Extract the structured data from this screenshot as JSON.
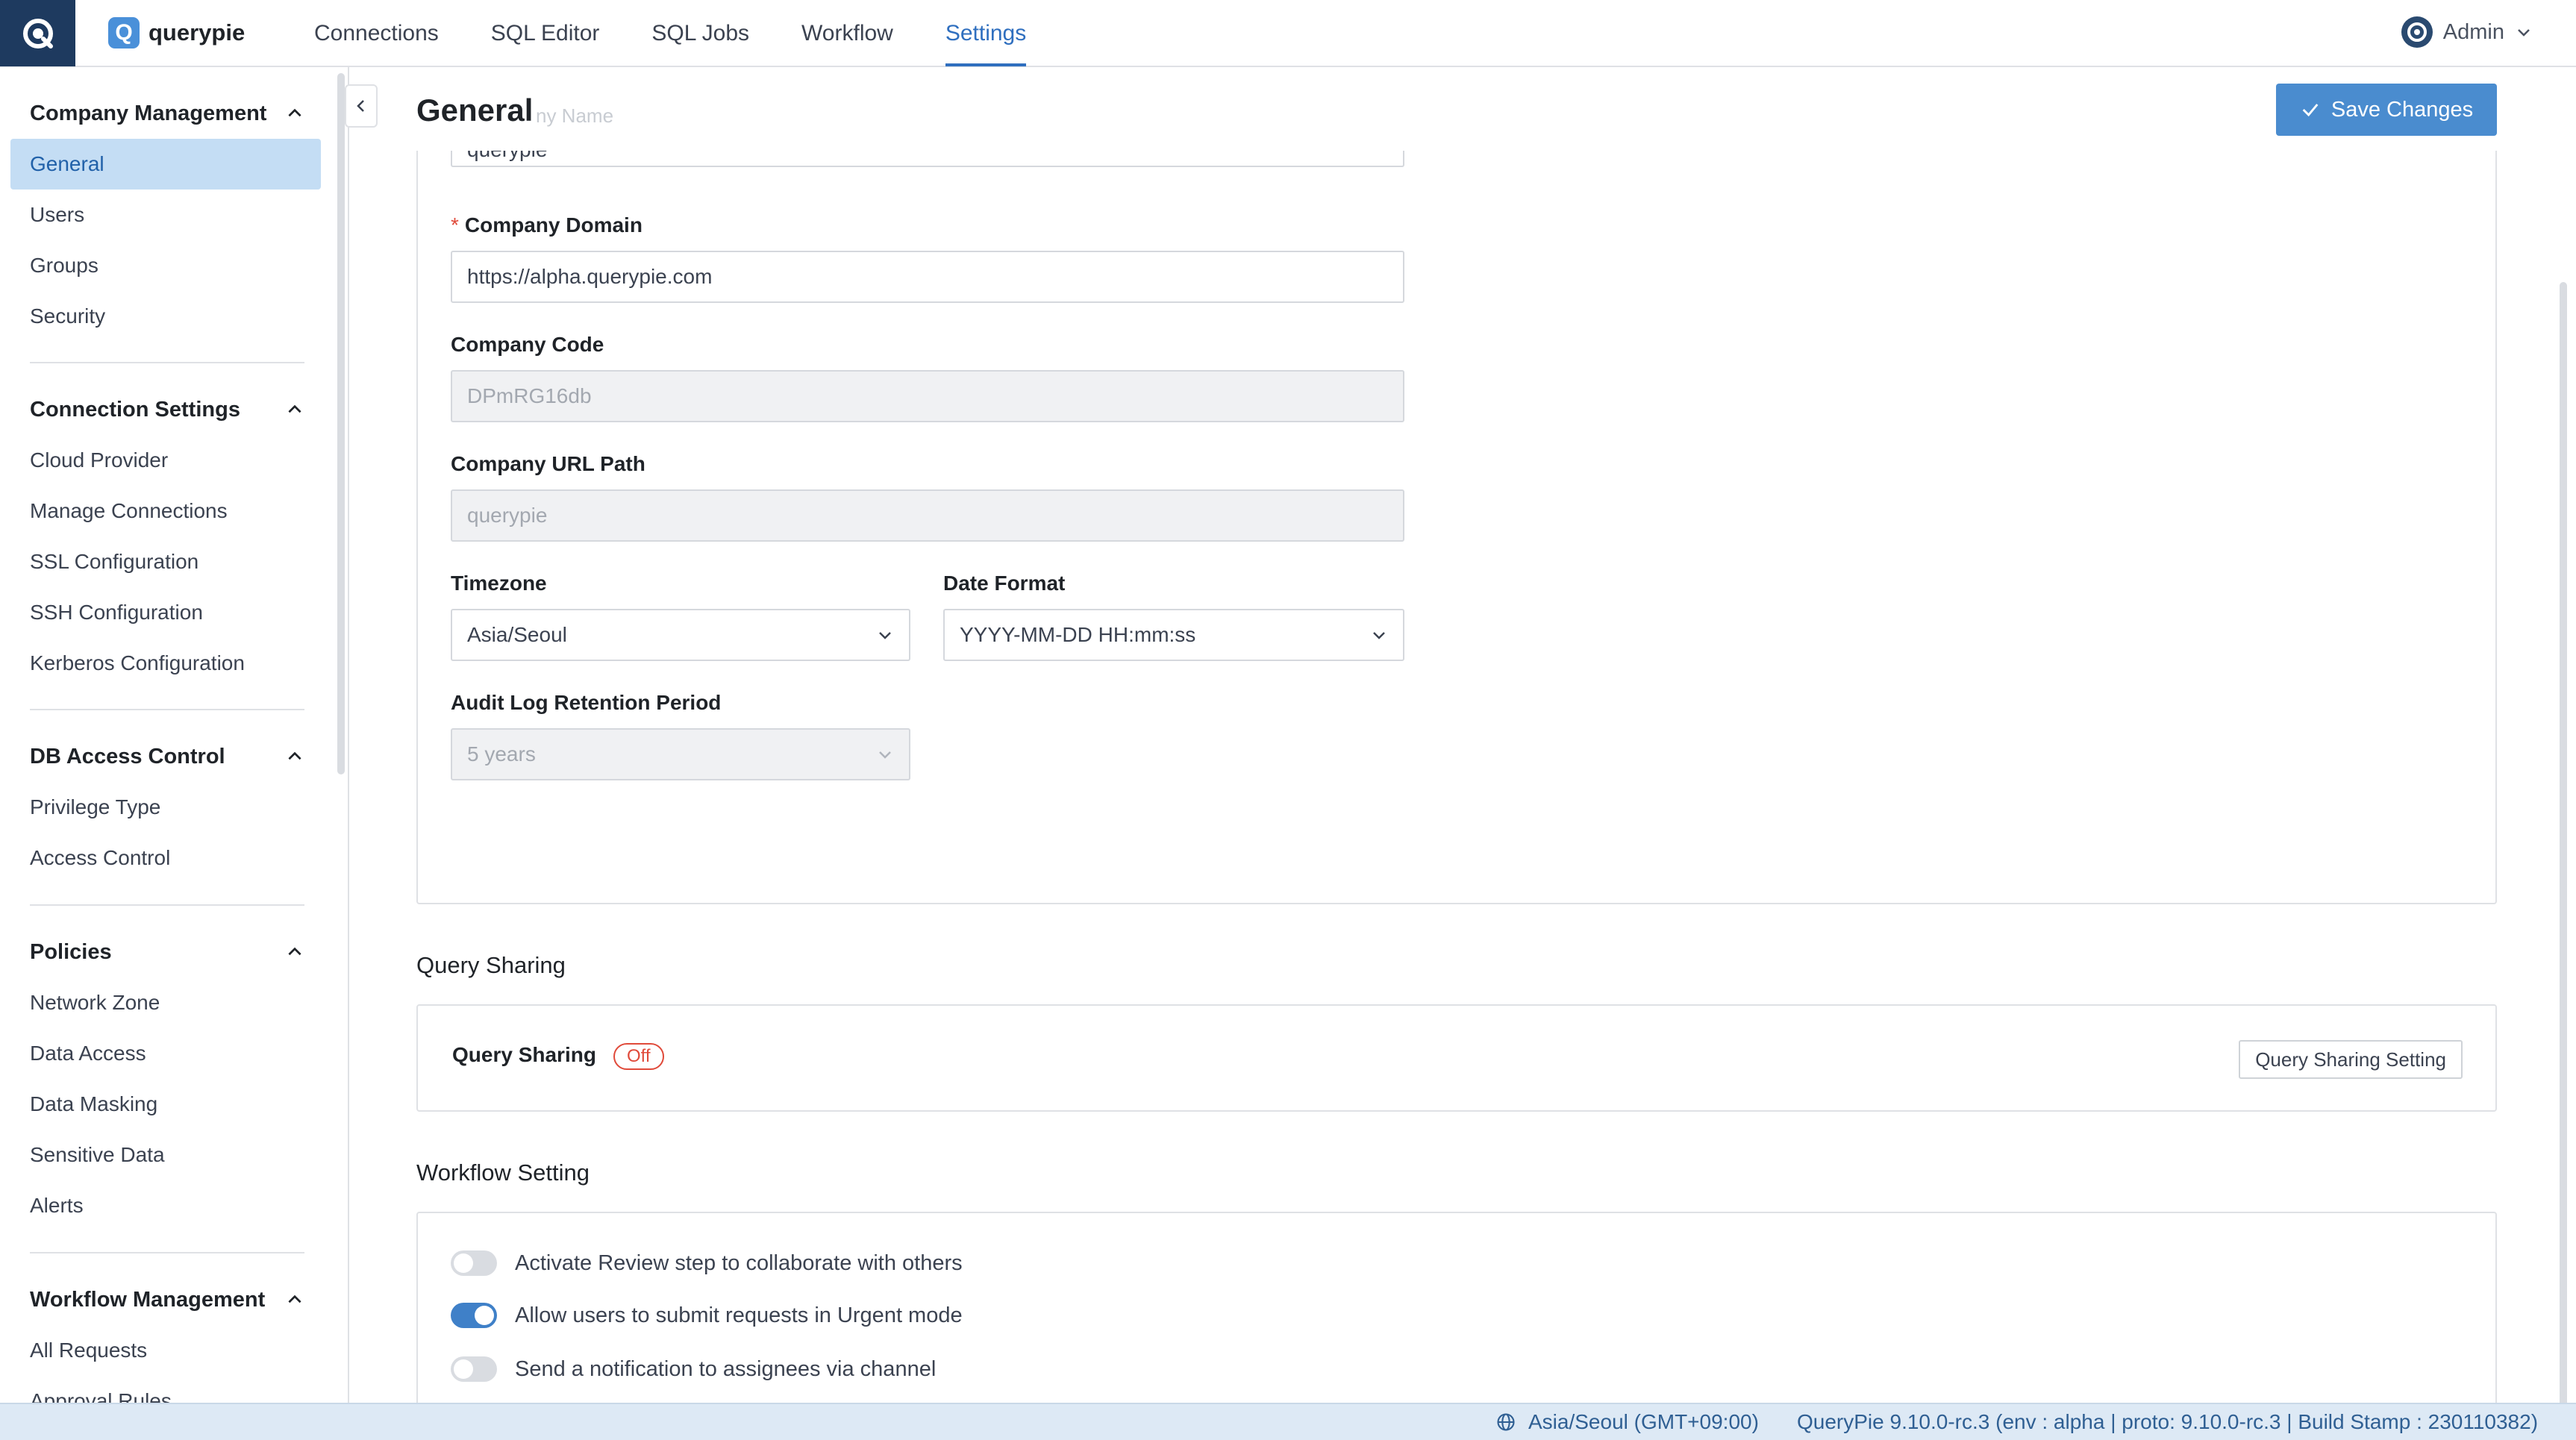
{
  "topnav": {
    "brand_name": "querypie",
    "brand_letter": "Q",
    "items": [
      {
        "label": "Connections"
      },
      {
        "label": "SQL Editor"
      },
      {
        "label": "SQL Jobs"
      },
      {
        "label": "Workflow"
      },
      {
        "label": "Settings",
        "active": true
      }
    ],
    "user_label": "Admin"
  },
  "sidebar": {
    "sections": [
      {
        "title": "Company Management",
        "items": [
          "General",
          "Users",
          "Groups",
          "Security"
        ]
      },
      {
        "title": "Connection Settings",
        "items": [
          "Cloud Provider",
          "Manage Connections",
          "SSL Configuration",
          "SSH Configuration",
          "Kerberos Configuration"
        ]
      },
      {
        "title": "DB Access Control",
        "items": [
          "Privilege Type",
          "Access Control"
        ]
      },
      {
        "title": "Policies",
        "items": [
          "Network Zone",
          "Data Access",
          "Data Masking",
          "Sensitive Data",
          "Alerts"
        ]
      },
      {
        "title": "Workflow Management",
        "items": [
          "All Requests",
          "Approval Rules"
        ]
      }
    ],
    "active_item": "General"
  },
  "page": {
    "title": "General",
    "ghost_label": "ny Name",
    "save_label": "Save Changes"
  },
  "general_form": {
    "company_name_value": "querypie",
    "company_domain_label": "Company Domain",
    "company_domain_required": "*",
    "company_domain_value": "https://alpha.querypie.com",
    "company_code_label": "Company Code",
    "company_code_value": "DPmRG16db",
    "company_url_path_label": "Company URL Path",
    "company_url_path_value": "querypie",
    "timezone_label": "Timezone",
    "timezone_value": "Asia/Seoul",
    "date_format_label": "Date Format",
    "date_format_value": "YYYY-MM-DD HH:mm:ss",
    "audit_log_label": "Audit Log Retention Period",
    "audit_log_value": "5 years"
  },
  "query_sharing": {
    "section_title": "Query Sharing",
    "label": "Query Sharing",
    "status": "Off",
    "setting_button": "Query Sharing Setting"
  },
  "workflow_setting": {
    "section_title": "Workflow Setting",
    "toggles": [
      {
        "label": "Activate Review step to collaborate with others",
        "on": false
      },
      {
        "label": "Allow users to submit requests in Urgent mode",
        "on": true
      },
      {
        "label": "Send a notification to assignees via channel",
        "on": false
      }
    ]
  },
  "statusbar": {
    "timezone": "Asia/Seoul (GMT+09:00)",
    "version": "QueryPie 9.10.0-rc.3 (env : alpha | proto: 9.10.0-rc.3 | Build Stamp : 230110382)"
  },
  "colors": {
    "accent": "#2f6fbf",
    "save_button": "#4a8ccf",
    "active_sidebar_bg": "#c4ddf4",
    "toggle_on": "#3f80c8",
    "off_badge": "#e04a3a",
    "statusbar_bg": "#dde9f5"
  }
}
